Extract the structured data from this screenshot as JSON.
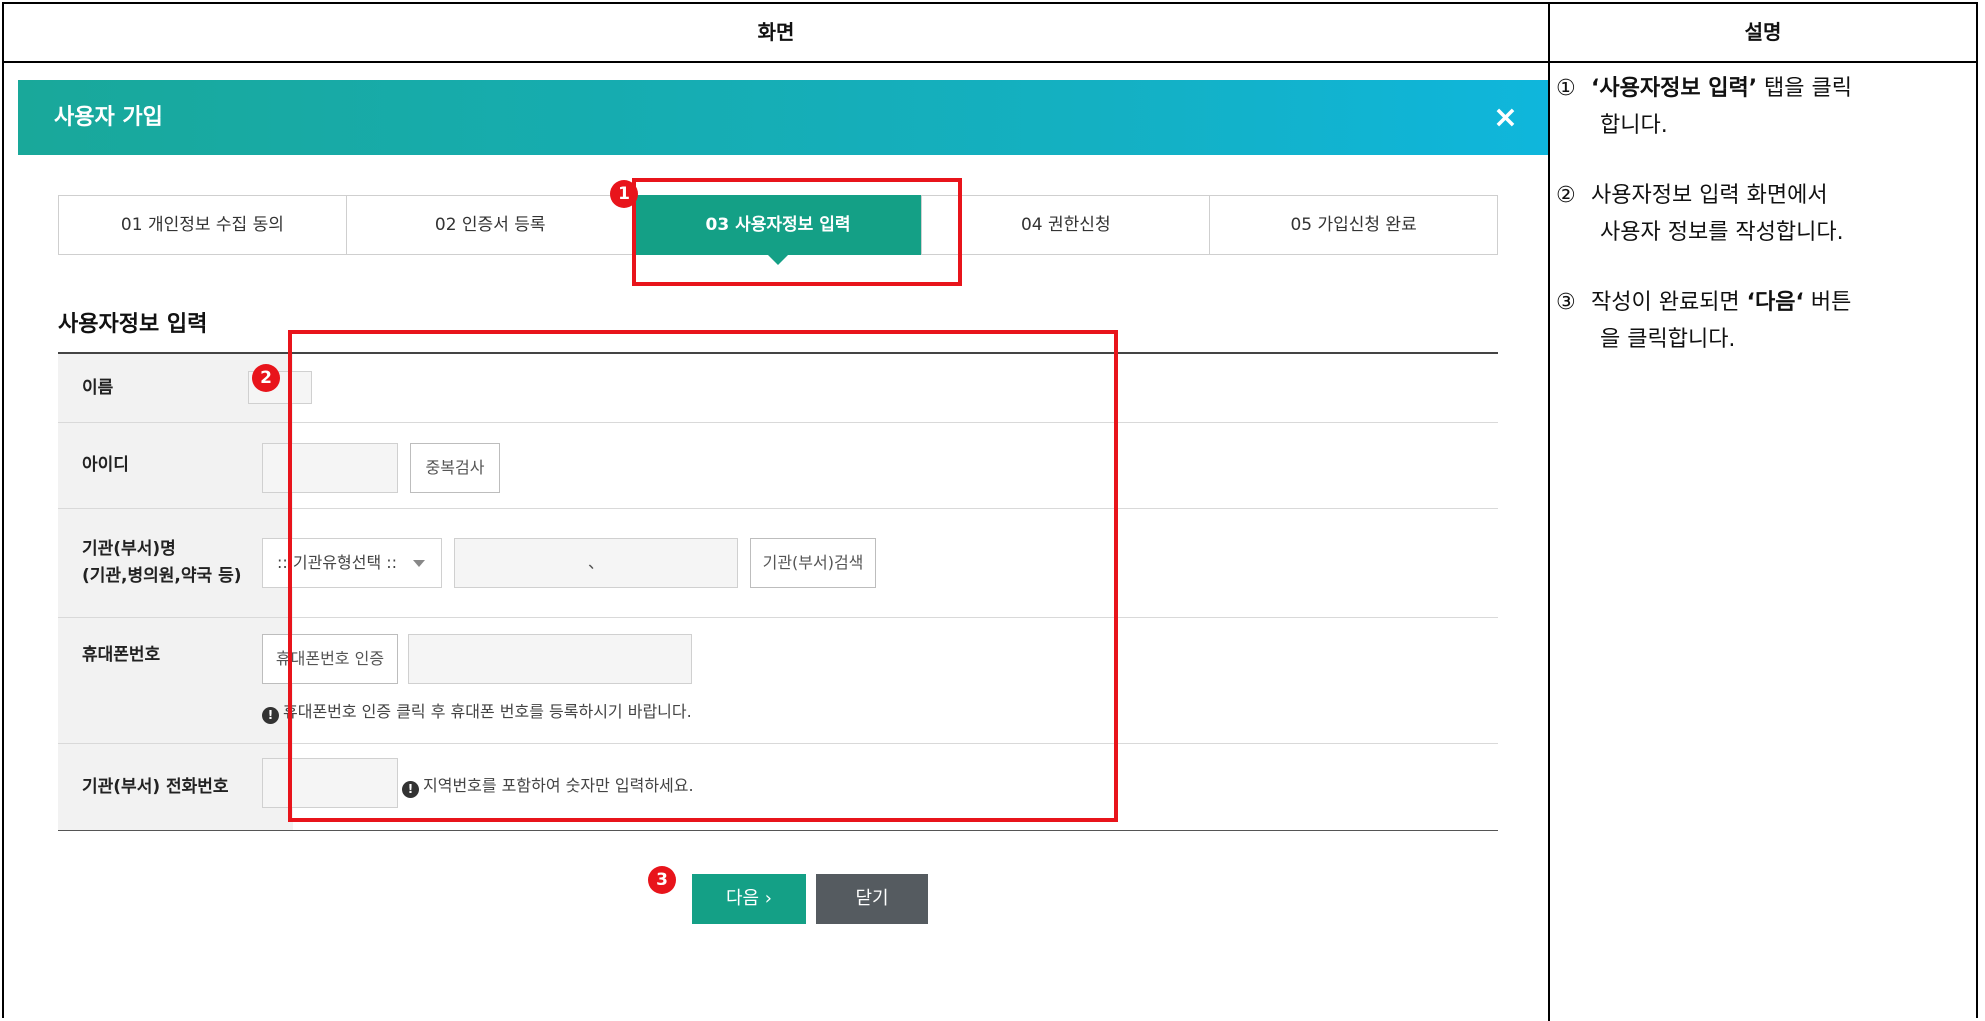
{
  "header": {
    "left": "화면",
    "right": "설명"
  },
  "modal": {
    "title": "사용자 가입",
    "close_icon": "×",
    "steps": [
      {
        "label": "01 개인정보 수집 동의"
      },
      {
        "label": "02 인증서 등록"
      },
      {
        "label": "03 사용자정보 입력",
        "active": true
      },
      {
        "label": "04 권한신청"
      },
      {
        "label": "05 가입신청 완료"
      }
    ],
    "section_title": "사용자정보 입력",
    "form": {
      "name_label": "이름",
      "id_label": "아이디",
      "dup_check": "중복검사",
      "org_label_1": "기관(부서)명",
      "org_label_2": "(기관,병의원,약국 등)",
      "org_select": ":: 기관유형선택 ::",
      "org_input_value": "、",
      "org_search": "기관(부서)검색",
      "phone_label": "휴대폰번호",
      "phone_verify": "휴대폰번호 인증",
      "phone_note": "휴대폰번호 인증 클릭 후 휴대폰 번호를 등록하시기 바랍니다.",
      "tel_label": "기관(부서) 전화번호",
      "tel_note": "지역번호를 포함하여 숫자만 입력하세요."
    },
    "next_button": "다음 ›",
    "close_button": "닫기"
  },
  "badges": {
    "b1": "1",
    "b2": "2",
    "b3": "3"
  },
  "description": {
    "item1_num": "①",
    "item1_bold": "‘사용자정보 입력’",
    "item1_rest": " 탭을 클릭",
    "item1_line2": "합니다.",
    "item2_num": "②",
    "item2_line1": "사용자정보 입력 화면에서",
    "item2_line2": "사용자 정보를 작성합니다.",
    "item3_num": "③",
    "item3_pre": "작성이 완료되면 ",
    "item3_bold": "‘다음‘",
    "item3_rest": " 버튼",
    "item3_line2": "을 클릭합니다."
  },
  "colors": {
    "accent": "#14a086",
    "highlight": "#e8141b",
    "title_gradient_end": "#0fb6dc"
  }
}
